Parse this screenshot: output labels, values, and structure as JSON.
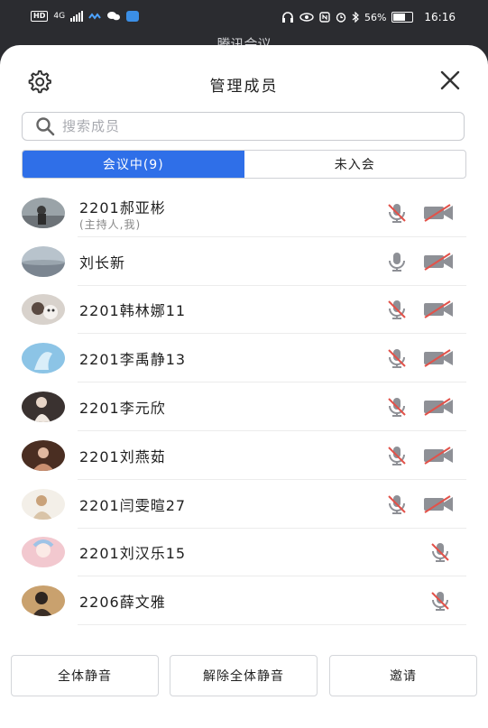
{
  "status_bar": {
    "hd": "HD",
    "network": "4G",
    "battery": "56%",
    "time": "16:16"
  },
  "background_title": "腾讯会议",
  "sheet": {
    "title": "管理成员",
    "search_placeholder": "搜索成员",
    "tabs": [
      {
        "label": "会议中(9)",
        "active": true
      },
      {
        "label": "未入会",
        "active": false
      }
    ]
  },
  "members": [
    {
      "name": "2201郝亚彬",
      "subtitle": "(主持人,我)",
      "mic_muted": true,
      "camera": "off"
    },
    {
      "name": "刘长新",
      "subtitle": "",
      "mic_muted": false,
      "camera": "off"
    },
    {
      "name": "2201韩林娜11",
      "subtitle": "",
      "mic_muted": true,
      "camera": "off"
    },
    {
      "name": "2201李禹静13",
      "subtitle": "",
      "mic_muted": true,
      "camera": "off"
    },
    {
      "name": "2201李元欣",
      "subtitle": "",
      "mic_muted": true,
      "camera": "off"
    },
    {
      "name": "2201刘燕茹",
      "subtitle": "",
      "mic_muted": true,
      "camera": "off"
    },
    {
      "name": "2201闫雯暄27",
      "subtitle": "",
      "mic_muted": true,
      "camera": "off"
    },
    {
      "name": "2201刘汉乐15",
      "subtitle": "",
      "mic_muted": true,
      "camera": "none"
    },
    {
      "name": "2206薛文雅",
      "subtitle": "",
      "mic_muted": true,
      "camera": "none"
    }
  ],
  "footer": {
    "mute_all": "全体静音",
    "unmute_all": "解除全体静音",
    "invite": "邀请"
  },
  "colors": {
    "accent": "#2f6fe8",
    "muted_slash": "#e2524a",
    "icon_grey": "#8e9096"
  }
}
